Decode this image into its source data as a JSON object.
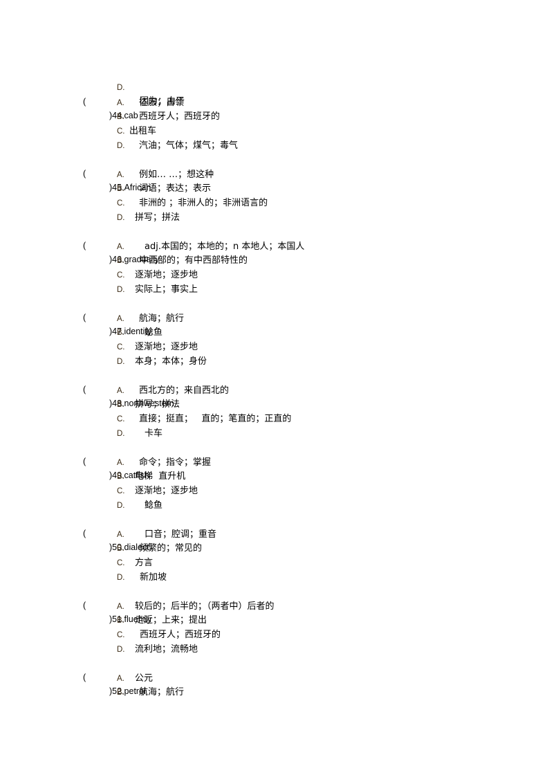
{
  "leading_option": {
    "label": "D.",
    "text": "因为；由于"
  },
  "questions": [
    {
      "paren": "(",
      "number_word": ")44.cab",
      "options": [
        {
          "label": "A.",
          "text": "征服；占领"
        },
        {
          "label": "B.",
          "text": "西班牙人；西班牙的"
        },
        {
          "label": "C.",
          "text": "出租车"
        },
        {
          "label": "D.",
          "text": "汽油；气体；煤气；毒气"
        }
      ]
    },
    {
      "paren": "(",
      "number_word": ")45.African",
      "options": [
        {
          "label": "A.",
          "text": "例如… …；想这种"
        },
        {
          "label": "B.",
          "text": "词语；表达；表示"
        },
        {
          "label": "C.",
          "text": "非洲的 ；非洲人的；非洲语言的"
        },
        {
          "label": "D.",
          "text": "拼写；拼法"
        }
      ]
    },
    {
      "paren": "(",
      "number_word": ")46.gradually",
      "options": [
        {
          "label": "A.",
          "text": "adj.本国的；本地的；n 本地人；本国人"
        },
        {
          "label": "B.",
          "text": "中西部的；有中西部特性的"
        },
        {
          "label": "C.",
          "text": "逐渐地；逐步地"
        },
        {
          "label": "D.",
          "text": "实际上；事实上"
        }
      ]
    },
    {
      "paren": "(",
      "number_word": ")47.identity",
      "options": [
        {
          "label": "A.",
          "text": "航海；航行"
        },
        {
          "label": "B.",
          "text": "鲶鱼"
        },
        {
          "label": "C.",
          "text": "逐渐地；逐步地"
        },
        {
          "label": "D.",
          "text": "本身；本体；身份"
        }
      ]
    },
    {
      "paren": "(",
      "number_word": ")48.northwestern",
      "options": [
        {
          "label": "A.",
          "text": "西北方的；来自西北的"
        },
        {
          "label": "B.",
          "text": "拼写；拼法"
        },
        {
          "label": "C.",
          "text": "直接；挺直；   直的；笔直的；正直的"
        },
        {
          "label": "D.",
          "text": "卡车"
        }
      ]
    },
    {
      "paren": "(",
      "number_word": ")49.catfish",
      "options": [
        {
          "label": "A.",
          "text": "命令；指令；掌握"
        },
        {
          "label": "B.",
          "text": "电梯  直升机"
        },
        {
          "label": "C.",
          "text": "逐渐地；逐步地"
        },
        {
          "label": "D.",
          "text": "鲶鱼"
        }
      ]
    },
    {
      "paren": "(",
      "number_word": ")50.dialect",
      "options": [
        {
          "label": "A.",
          "text": "口音；腔调；重音"
        },
        {
          "label": "B.",
          "text": "频繁的；常见的"
        },
        {
          "label": "C.",
          "text": "方言"
        },
        {
          "label": "D.",
          "text": "新加坡"
        }
      ]
    },
    {
      "paren": "(",
      "number_word": ")51.fluently",
      "options": [
        {
          "label": "A.",
          "text": "较后的；后半的；（两者中）后者的"
        },
        {
          "label": "B.",
          "text": "走近；上来；提出"
        },
        {
          "label": "C.",
          "text": "西班牙人；西班牙的"
        },
        {
          "label": "D.",
          "text": "流利地；流畅地"
        }
      ]
    },
    {
      "paren": "(",
      "number_word": ")52.petrol",
      "options": [
        {
          "label": "A.",
          "text": "公元"
        },
        {
          "label": "B.",
          "text": "航海；航行"
        }
      ]
    }
  ]
}
